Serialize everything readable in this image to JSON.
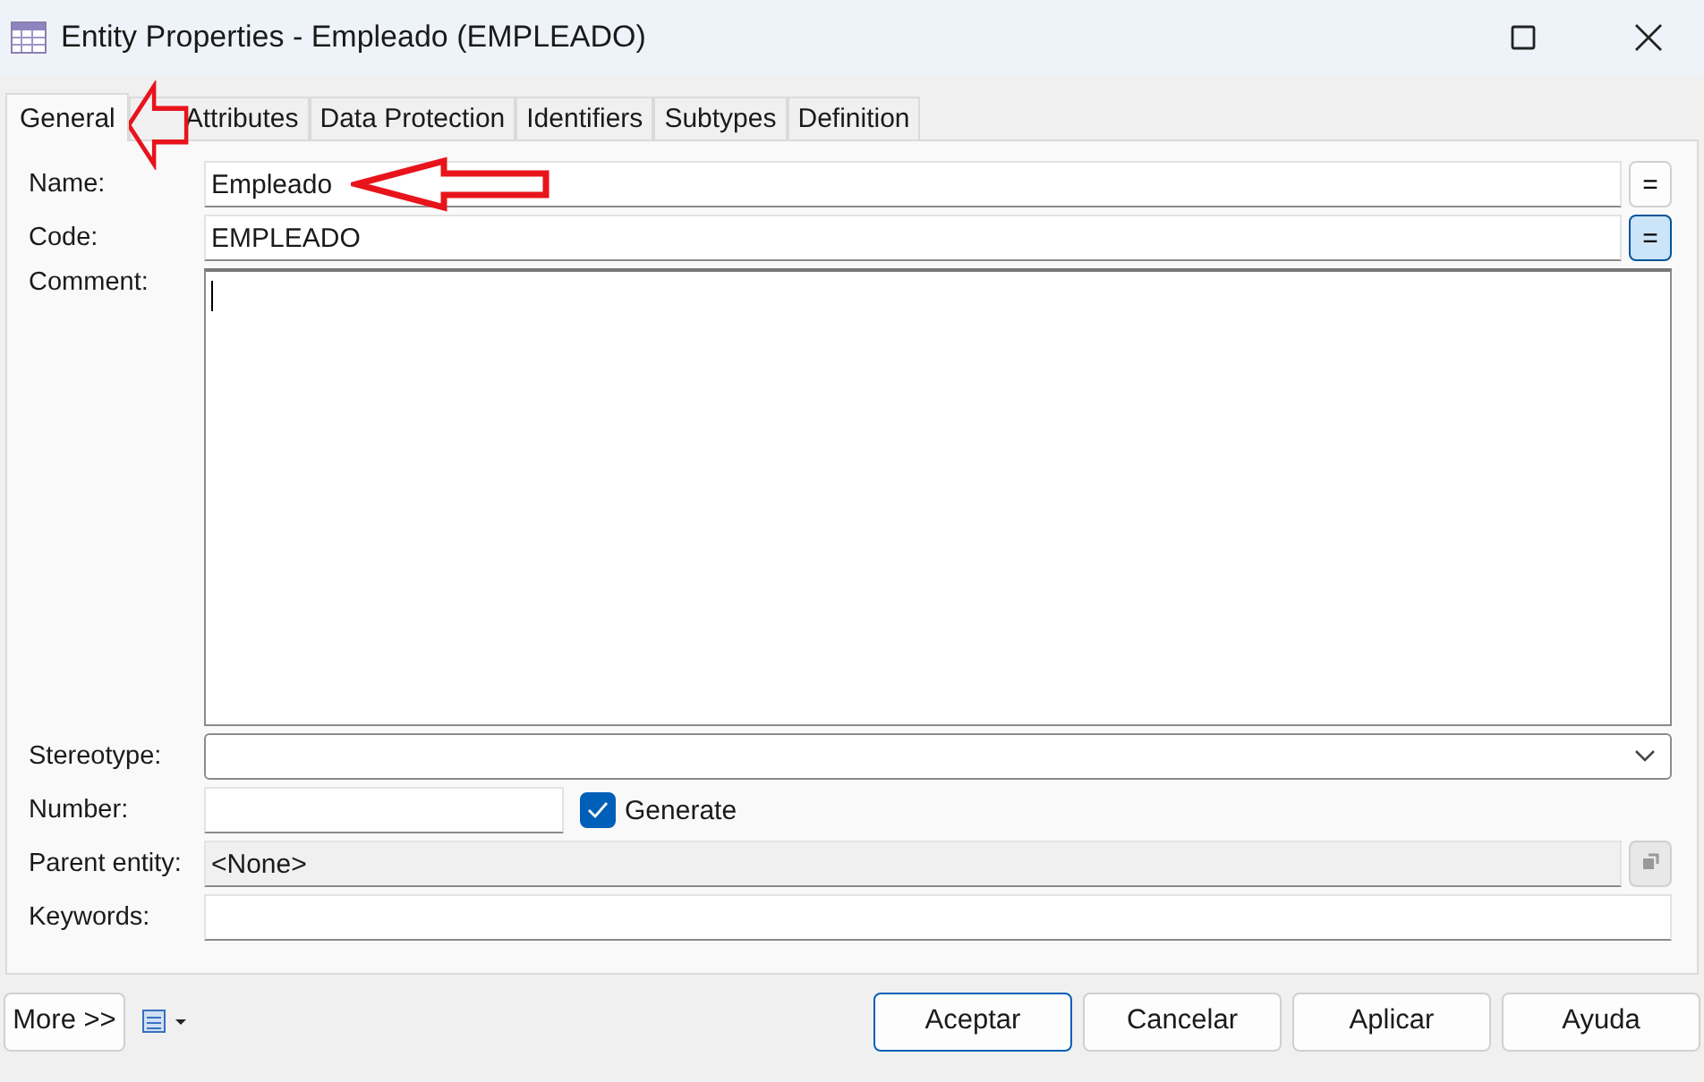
{
  "window": {
    "title": "Entity Properties - Empleado (EMPLEADO)"
  },
  "tabs": [
    {
      "label": "General",
      "selected": true
    },
    {
      "label": "Attributes",
      "selected": false
    },
    {
      "label": "Data Protection",
      "selected": false
    },
    {
      "label": "Identifiers",
      "selected": false
    },
    {
      "label": "Subtypes",
      "selected": false
    },
    {
      "label": "Definition",
      "selected": false
    }
  ],
  "form": {
    "name": {
      "label": "Name:",
      "value": "Empleado",
      "equal_button": "=",
      "equal_pressed": false
    },
    "code": {
      "label": "Code:",
      "value": "EMPLEADO",
      "equal_button": "=",
      "equal_pressed": true
    },
    "comment": {
      "label": "Comment:"
    },
    "stereotype": {
      "label": "Stereotype:"
    },
    "number": {
      "label": "Number:",
      "generate": {
        "label": "Generate",
        "checked": true
      }
    },
    "parent_entity": {
      "label": "Parent entity:",
      "value": "<None>",
      "disabled": true
    },
    "keywords": {
      "label": "Keywords:"
    }
  },
  "buttons": {
    "more": "More >>",
    "actions": [
      {
        "label": "Aceptar",
        "default": true
      },
      {
        "label": "Cancelar",
        "default": false
      },
      {
        "label": "Aplicar",
        "default": false
      },
      {
        "label": "Ayuda",
        "default": false
      }
    ]
  }
}
